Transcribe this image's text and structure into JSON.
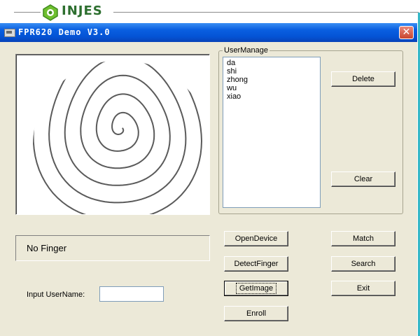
{
  "brand": {
    "text": "INJES",
    "icon": "injes-logo-icon",
    "color": "#2d6f2f"
  },
  "window": {
    "title": "FPR620 Demo V3.0",
    "icon": "app-icon",
    "close_icon": "close-icon",
    "close_glyph": "✕"
  },
  "user_manage": {
    "label": "UserManage",
    "users": [
      "da",
      "shi",
      "zhong",
      "wu",
      "xiao"
    ]
  },
  "buttons": {
    "delete": "Delete",
    "clear": "Clear",
    "open_device": "OpenDevice",
    "match": "Match",
    "detect_finger": "DetectFinger",
    "search": "Search",
    "get_image": "GetImage",
    "exit": "Exit",
    "enroll": "Enroll"
  },
  "status": {
    "text": "No Finger"
  },
  "input": {
    "label": "Input UserName:",
    "value": ""
  },
  "fingerprint": {
    "icon": "fingerprint-image"
  }
}
